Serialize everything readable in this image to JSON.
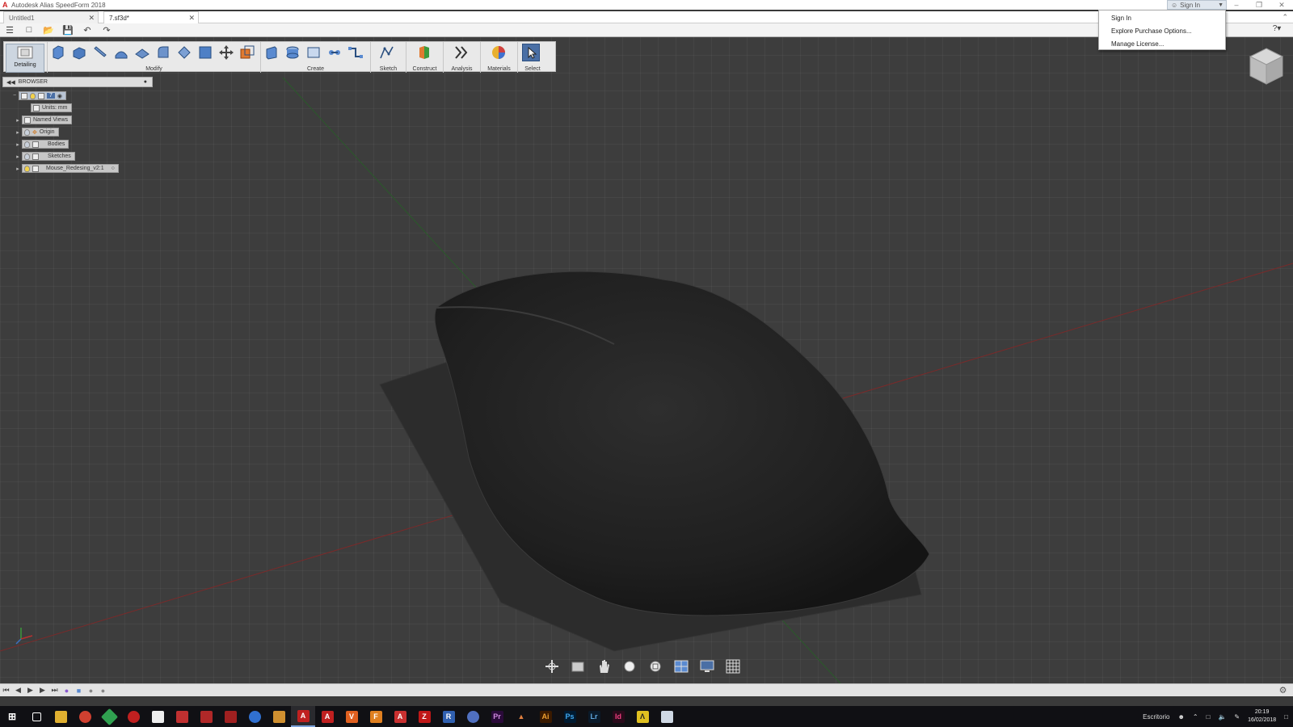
{
  "window": {
    "title": "Autodesk Alias SpeedForm 2018",
    "signin_label": "Sign In"
  },
  "tabs": [
    {
      "label": "Untitled1"
    },
    {
      "label": "7.sf3d*"
    }
  ],
  "signin_menu": [
    "Sign In",
    "Explore Purchase Options...",
    "Manage License..."
  ],
  "toolbar": {
    "detailing_label": "Detailing",
    "modify_label": "Modify",
    "create_label": "Create",
    "sketch_label": "Sketch",
    "construct_label": "Construct",
    "analysis_label": "Analysis",
    "materials_label": "Materials",
    "select_label": "Select"
  },
  "browser": {
    "title": "BROWSER",
    "root_label": "7",
    "items": [
      {
        "label": "Units: mm"
      },
      {
        "label": "Named Views"
      },
      {
        "label": "Origin"
      },
      {
        "label": "Bodies"
      },
      {
        "label": "Sketches"
      },
      {
        "label": "Mouse_Redesing_v2:1"
      }
    ]
  },
  "taskbar": {
    "desktop_label": "Escritorio",
    "time": "20:19",
    "date": "16/02/2018"
  },
  "colors": {
    "accent": "#4a6fa5",
    "viewport_bg": "#3d3d3d",
    "axis_red": "#8a2a2a",
    "axis_green": "#2a6a2a"
  }
}
